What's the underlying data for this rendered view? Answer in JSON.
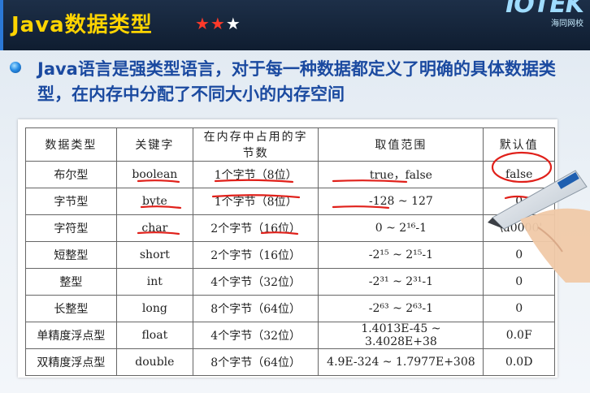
{
  "header": {
    "title": "Java数据类型",
    "stars_on": "★★",
    "stars_off": "★",
    "logo_text": "IOTEK",
    "logo_sub": "海同网校"
  },
  "bullet": {
    "text": "Java语言是强类型语言，对于每一种数据都定义了明确的具体数据类型，在内存中分配了不同大小的内存空间"
  },
  "table": {
    "headers": [
      "数据类型",
      "关键字",
      "在内存中占用的字节数",
      "取值范围",
      "默认值"
    ],
    "rows": [
      [
        "布尔型",
        "boolean",
        "1个字节（8位）",
        "true，false",
        "false"
      ],
      [
        "字节型",
        "byte",
        "1个字节（8位）",
        "-128 ~ 127",
        "0"
      ],
      [
        "字符型",
        "char",
        "2个字节（16位）",
        "0 ~ 2¹⁶-1",
        "'\\u0000'"
      ],
      [
        "短整型",
        "short",
        "2个字节（16位）",
        "-2¹⁵ ~ 2¹⁵-1",
        "0"
      ],
      [
        "整型",
        "int",
        "4个字节（32位）",
        "-2³¹ ~ 2³¹-1",
        "0"
      ],
      [
        "长整型",
        "long",
        "8个字节（64位）",
        "-2⁶³ ~ 2⁶³-1",
        "0"
      ],
      [
        "单精度浮点型",
        "float",
        "4个字节（32位）",
        "1.4013E-45 ~ 3.4028E+38",
        "0.0F"
      ],
      [
        "双精度浮点型",
        "double",
        "8个字节（64位）",
        "4.9E-324 ~ 1.7977E+308",
        "0.0D"
      ]
    ]
  },
  "colors": {
    "title": "#ffd400",
    "bullet_text": "#1b4aa0",
    "annotation": "#e0201a",
    "header_bg": "#14233a"
  }
}
